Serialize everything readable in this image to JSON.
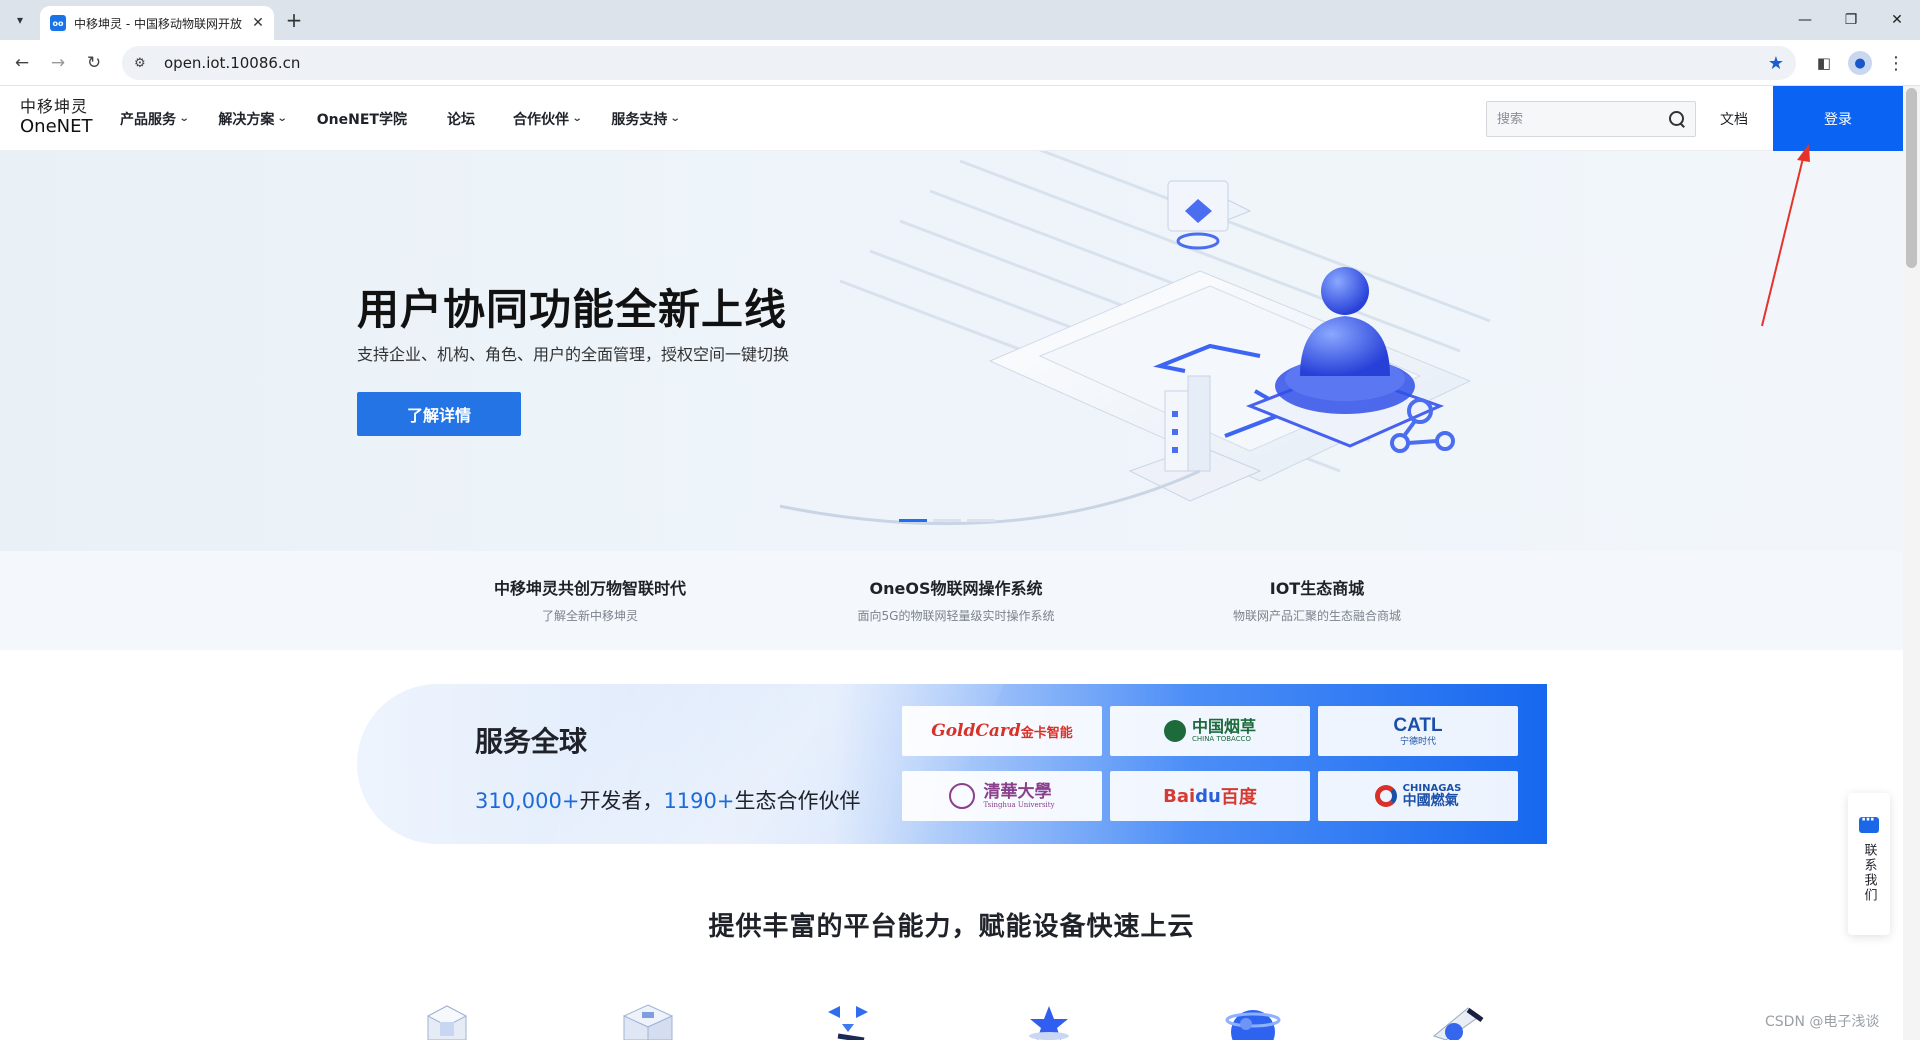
{
  "browser": {
    "tab_title": "中移坤灵 - 中国移动物联网开放",
    "favicon_text": "oo",
    "url": "open.iot.10086.cn"
  },
  "header": {
    "logo_cn": "中移坤灵",
    "logo_en": "OneNET",
    "nav": [
      {
        "label": "产品服务",
        "dropdown": true
      },
      {
        "label": "解决方案",
        "dropdown": true
      },
      {
        "label": "OneNET学院",
        "dropdown": false
      },
      {
        "label": "论坛",
        "dropdown": false
      },
      {
        "label": "合作伙伴",
        "dropdown": true
      },
      {
        "label": "服务支持",
        "dropdown": true
      }
    ],
    "search_placeholder": "搜索",
    "docs": "文档",
    "login": "登录"
  },
  "hero": {
    "title": "用户协同功能全新上线",
    "subtitle": "支持企业、机构、角色、用户的全面管理，授权空间一键切换",
    "button": "了解详情",
    "slide_count": 3,
    "active_slide": 1
  },
  "features": [
    {
      "title": "中移坤灵共创万物智联时代",
      "desc": "了解全新中移坤灵"
    },
    {
      "title": "OneOS物联网操作系统",
      "desc": "面向5G的物联网轻量级实时操作系统"
    },
    {
      "title": "IOT生态商城",
      "desc": "物联网产品汇聚的生态融合商城"
    }
  ],
  "global": {
    "title": "服务全球",
    "developers": "310,000+",
    "developers_label": "开发者，",
    "partners_count": "1190+",
    "partners_label": "生态合作伙伴",
    "partners": [
      {
        "main": "GoldCard",
        "suffix": "金卡智能"
      },
      {
        "main": "中国烟草",
        "sub": "CHINA TOBACCO"
      },
      {
        "main": "CATL",
        "sub": "宁德时代"
      },
      {
        "main": "清華大學",
        "sub": "Tsinghua University"
      },
      {
        "main": "Bai",
        "paw": "du",
        "suffix": "百度"
      },
      {
        "main": "CHINAGAS",
        "sub": "中國燃氣"
      }
    ]
  },
  "capabilities": {
    "title": "提供丰富的平台能力，赋能设备快速上云",
    "icons": [
      "cube-icon",
      "server-icon",
      "arrows-icon",
      "star-icon",
      "sphere-icon",
      "camera-icon"
    ]
  },
  "contact": "联系我们",
  "watermark": "CSDN @电子浅谈",
  "colors": {
    "primary": "#0b63f3",
    "annotation": "#e5332a"
  }
}
